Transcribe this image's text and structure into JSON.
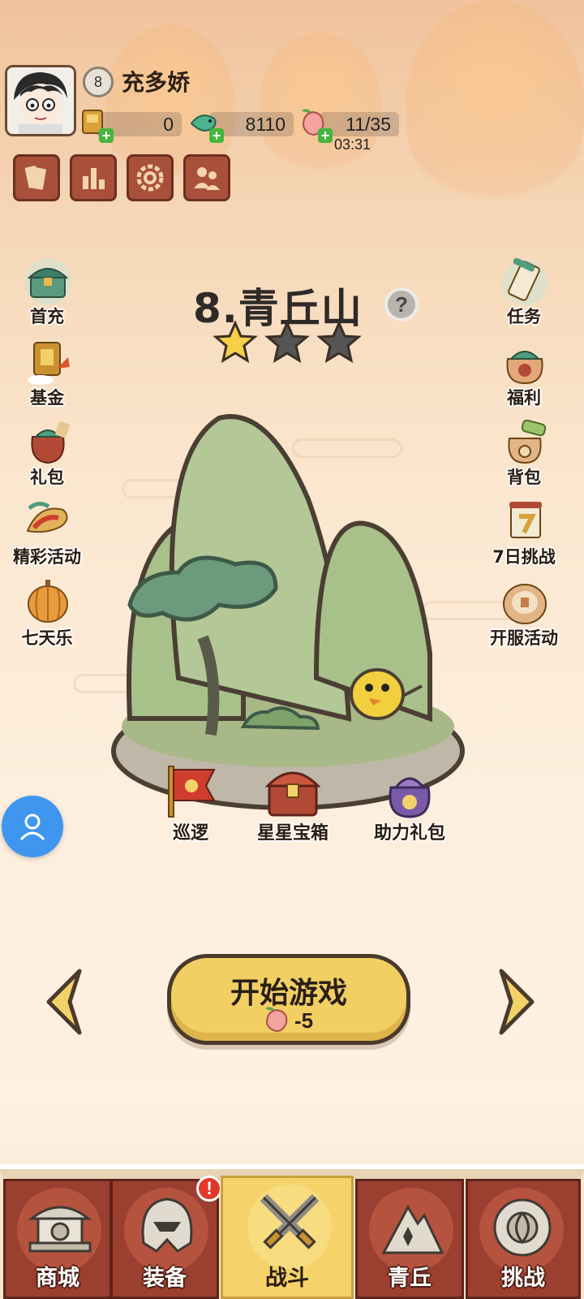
{
  "player": {
    "level": "8",
    "name": "充多娇",
    "resources": [
      {
        "icon": "gold-ticket-icon",
        "value": "0"
      },
      {
        "icon": "jade-fish-icon",
        "value": "8110"
      },
      {
        "icon": "peach-stamina-icon",
        "value": "11/35"
      }
    ],
    "stamina_timer": "03:31"
  },
  "top_buttons": [
    "cards-icon",
    "ranking-icon",
    "settings-gear-icon",
    "friends-icon"
  ],
  "left_menu": [
    {
      "name": "first-recharge",
      "label": "首充",
      "icon": "treasure-chest-icon"
    },
    {
      "name": "fund",
      "label": "基金",
      "icon": "fund-scroll-icon"
    },
    {
      "name": "gift-pack",
      "label": "礼包",
      "icon": "gift-bag-icon"
    },
    {
      "name": "events",
      "label": "精彩活动",
      "icon": "dragon-event-icon"
    },
    {
      "name": "seven-days",
      "label": "七天乐",
      "icon": "lantern-icon"
    }
  ],
  "right_menu": [
    {
      "name": "tasks",
      "label": "任务",
      "icon": "scroll-icon"
    },
    {
      "name": "welfare",
      "label": "福利",
      "icon": "welfare-bag-icon"
    },
    {
      "name": "backpack",
      "label": "背包",
      "icon": "backpack-icon"
    },
    {
      "name": "seven-day-challenge",
      "label": "7日挑战",
      "icon": "challenge-banner-icon"
    },
    {
      "name": "server-event",
      "label": "开服活动",
      "icon": "server-drum-icon"
    }
  ],
  "stage": {
    "title": "8.青丘山",
    "stars_earned": 1,
    "stars_total": 3
  },
  "stage_items": [
    {
      "name": "patrol",
      "label": "巡逻"
    },
    {
      "name": "star-chest",
      "label": "星星宝箱"
    },
    {
      "name": "assist-gift",
      "label": "助力礼包"
    }
  ],
  "start": {
    "label": "开始游戏",
    "cost": "-5"
  },
  "nav": [
    {
      "name": "shop",
      "label": "商城",
      "active": false
    },
    {
      "name": "equipment",
      "label": "装备",
      "active": false,
      "alert": "!"
    },
    {
      "name": "battle",
      "label": "战斗",
      "active": true
    },
    {
      "name": "qingqiu",
      "label": "青丘",
      "active": false
    },
    {
      "name": "challenge",
      "label": "挑战",
      "active": false
    }
  ],
  "colors": {
    "tab": "#9b3f30",
    "tab_active": "#f5d36a",
    "start_button": "#f2cf63",
    "floating_user": "#3f96ef"
  }
}
